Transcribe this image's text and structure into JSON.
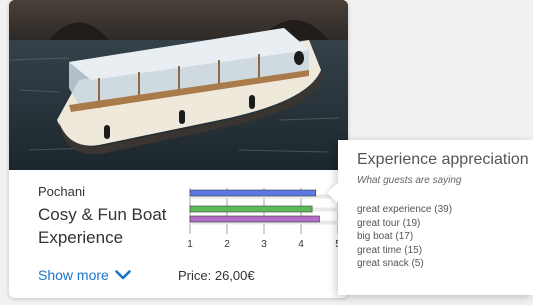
{
  "card": {
    "photo_alt": "boat-photo",
    "operator": "Pochani",
    "title": "Cosy & Fun Boat Experience",
    "show_more_label": "Show more",
    "price_label": "Price: 26,00€"
  },
  "chart_data": {
    "type": "bar",
    "orientation": "horizontal",
    "categories": [
      "blue",
      "green",
      "purple"
    ],
    "values": [
      4.4,
      4.3,
      4.5
    ],
    "colors": [
      "#5b79e6",
      "#5dbb57",
      "#b36cc7"
    ],
    "xlim": [
      1,
      5
    ],
    "ticks": [
      "1",
      "2",
      "3",
      "4",
      "5"
    ],
    "grid": true
  },
  "popover": {
    "title": "Experience appreciation",
    "subtitle": "What guests are saying",
    "items": [
      "great experience (39)",
      "great tour (19)",
      "big boat  (17)",
      "great time (15)",
      "great snack (5)"
    ]
  }
}
